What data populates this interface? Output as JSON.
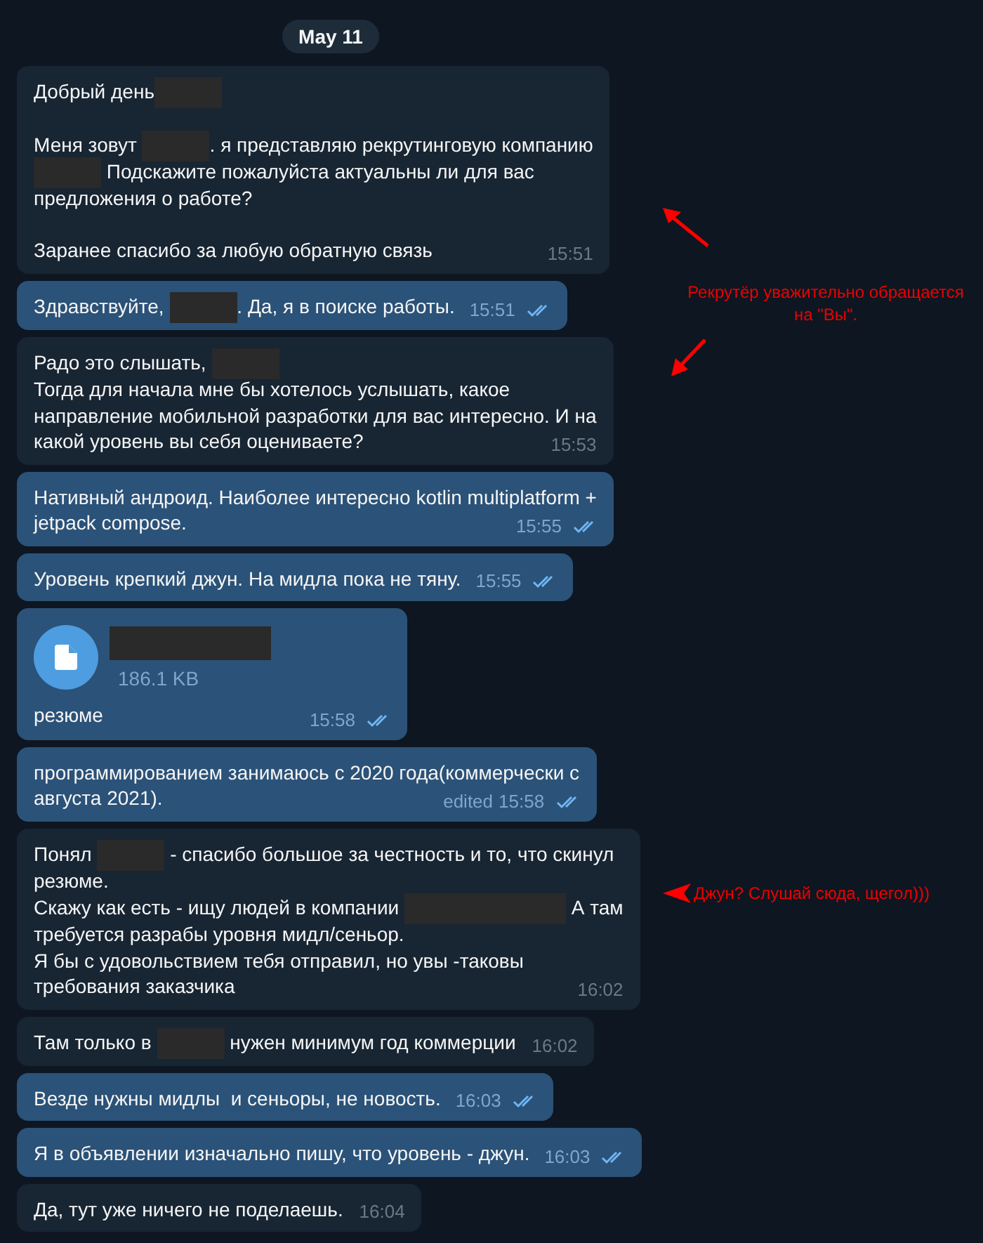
{
  "date_label": "May 11",
  "messages": [
    {
      "kind": "text",
      "outgoing": false,
      "time": "15:51",
      "lines": [
        {
          "kind": "text",
          "segments": [
            {
              "kind": "text",
              "text": "Добрый день"
            },
            {
              "kind": "redacted"
            }
          ]
        },
        {
          "kind": "blank"
        },
        {
          "kind": "text",
          "segments": [
            {
              "kind": "text",
              "text": "Меня зовут "
            },
            {
              "kind": "redacted"
            },
            {
              "kind": "text",
              "text": ". я представляю рекрутинговую компанию"
            }
          ]
        },
        {
          "kind": "text",
          "segments": [
            {
              "kind": "redacted"
            },
            {
              "kind": "text",
              "text": " Подскажите пожалуйста актуальны ли для вас"
            }
          ]
        },
        {
          "kind": "text",
          "segments": [
            {
              "kind": "text",
              "text": "предложения о работе?"
            }
          ]
        },
        {
          "kind": "blank"
        },
        {
          "kind": "text",
          "segments": [
            {
              "kind": "text",
              "text": "Заранее спасибо за любую обратную связь"
            }
          ]
        }
      ]
    },
    {
      "kind": "text",
      "outgoing": true,
      "time": "15:51",
      "read": true,
      "lines": [
        {
          "kind": "text",
          "segments": [
            {
              "kind": "text",
              "text": "Здравствуйте, "
            },
            {
              "kind": "redacted"
            },
            {
              "kind": "text",
              "text": ". Да, я в поиске работы."
            }
          ]
        }
      ]
    },
    {
      "kind": "text",
      "outgoing": false,
      "time": "15:53",
      "lines": [
        {
          "kind": "text",
          "segments": [
            {
              "kind": "text",
              "text": "Радо это слышать, "
            },
            {
              "kind": "redacted"
            }
          ]
        },
        {
          "kind": "text",
          "segments": [
            {
              "kind": "text",
              "text": "Тогда для начала мне бы хотелось услышать, какое"
            }
          ]
        },
        {
          "kind": "text",
          "segments": [
            {
              "kind": "text",
              "text": "направление мобильной разработки для вас интересно. И на"
            }
          ]
        },
        {
          "kind": "text",
          "segments": [
            {
              "kind": "text",
              "text": "какой уровень вы себя оцениваете?"
            }
          ]
        }
      ]
    },
    {
      "kind": "text",
      "outgoing": true,
      "time": "15:55",
      "read": true,
      "lines": [
        {
          "kind": "text",
          "segments": [
            {
              "kind": "text",
              "text": "Нативный андроид. Наиболее интересно kotlin multiplatform +"
            }
          ]
        },
        {
          "kind": "text",
          "segments": [
            {
              "kind": "text",
              "text": "jetpack compose."
            }
          ]
        }
      ]
    },
    {
      "kind": "text",
      "outgoing": true,
      "time": "15:55",
      "read": true,
      "lines": [
        {
          "kind": "text",
          "segments": [
            {
              "kind": "text",
              "text": "Уровень крепкий джун. На мидла пока не тяну."
            }
          ]
        }
      ]
    },
    {
      "kind": "file",
      "outgoing": true,
      "time": "15:58",
      "read": true,
      "file_size": "186.1 KB",
      "caption": "резюме"
    },
    {
      "kind": "text",
      "outgoing": true,
      "time": "15:58",
      "read": true,
      "edited_label": "edited",
      "lines": [
        {
          "kind": "text",
          "segments": [
            {
              "kind": "text",
              "text": "программированием занимаюсь с 2020 года(коммерчески с"
            }
          ]
        },
        {
          "kind": "text",
          "segments": [
            {
              "kind": "text",
              "text": "августа 2021)."
            }
          ]
        }
      ]
    },
    {
      "kind": "text",
      "outgoing": false,
      "time": "16:02",
      "lines": [
        {
          "kind": "text",
          "segments": [
            {
              "kind": "text",
              "text": "Понял "
            },
            {
              "kind": "redacted"
            },
            {
              "kind": "text",
              "text": " - спасибо большое за честность и то, что скинул"
            }
          ]
        },
        {
          "kind": "text",
          "segments": [
            {
              "kind": "text",
              "text": "резюме."
            }
          ]
        },
        {
          "kind": "text",
          "segments": [
            {
              "kind": "text",
              "text": "Скажу как есть - ищу людей в компании "
            },
            {
              "kind": "redacted_long"
            },
            {
              "kind": "text",
              "text": " А там"
            }
          ]
        },
        {
          "kind": "text",
          "segments": [
            {
              "kind": "text",
              "text": "требуется разрабы уровня мидл/сеньор."
            }
          ]
        },
        {
          "kind": "text",
          "segments": [
            {
              "kind": "text",
              "text": "Я бы с удовольствием тебя отправил, но увы -таковы"
            }
          ]
        },
        {
          "kind": "text",
          "segments": [
            {
              "kind": "text",
              "text": "требования заказчика"
            }
          ]
        }
      ]
    },
    {
      "kind": "text",
      "outgoing": false,
      "time": "16:02",
      "lines": [
        {
          "kind": "text",
          "segments": [
            {
              "kind": "text",
              "text": "Там только в "
            },
            {
              "kind": "redacted"
            },
            {
              "kind": "text",
              "text": " нужен минимум год коммерции"
            }
          ]
        }
      ]
    },
    {
      "kind": "text",
      "outgoing": true,
      "time": "16:03",
      "read": true,
      "lines": [
        {
          "kind": "text",
          "segments": [
            {
              "kind": "text",
              "text": "Везде нужны мидлы  и сеньоры, не новость."
            }
          ]
        }
      ]
    },
    {
      "kind": "text",
      "outgoing": true,
      "time": "16:03",
      "read": true,
      "lines": [
        {
          "kind": "text",
          "segments": [
            {
              "kind": "text",
              "text": "Я в объявлении изначально пишу, что уровень - джун."
            }
          ]
        }
      ]
    },
    {
      "kind": "text",
      "outgoing": false,
      "time": "16:04",
      "lines": [
        {
          "kind": "text",
          "segments": [
            {
              "kind": "text",
              "text": "Да, тут уже ничего не поделаешь."
            }
          ]
        }
      ]
    }
  ],
  "annotations": [
    {
      "kind": "double_arrow",
      "lines": [
        "Рекрутёр уважительно обращается",
        "на \"Вы\"."
      ]
    },
    {
      "kind": "left_arrow",
      "lines": [
        "Джун? Слушай сюда, щегол)))"
      ]
    }
  ]
}
